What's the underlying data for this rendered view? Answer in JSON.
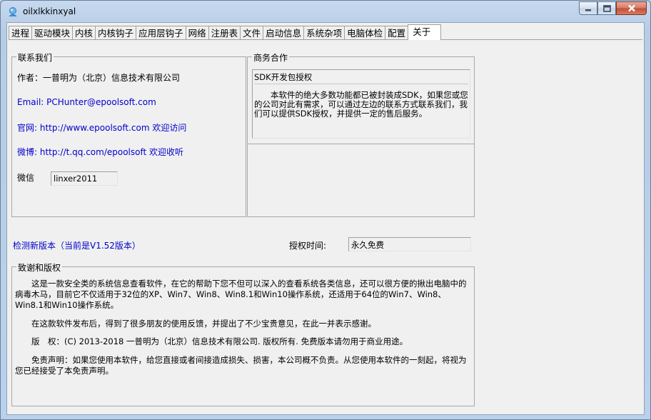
{
  "window": {
    "title": "oilxlkkinxyal"
  },
  "tabs": [
    {
      "label": "进程"
    },
    {
      "label": "驱动模块"
    },
    {
      "label": "内核"
    },
    {
      "label": "内核钩子"
    },
    {
      "label": "应用层钩子"
    },
    {
      "label": "网络"
    },
    {
      "label": "注册表"
    },
    {
      "label": "文件"
    },
    {
      "label": "启动信息"
    },
    {
      "label": "系统杂项"
    },
    {
      "label": "电脑体检"
    },
    {
      "label": "配置"
    },
    {
      "label": "关于"
    }
  ],
  "contact": {
    "group_title": "联系我们",
    "author": "作者：一普明为（北京）信息技术有限公司",
    "email": "Email: PCHunter@epoolsoft.com",
    "website": "官网: http://www.epoolsoft.com 欢迎访问",
    "weibo": "微博: http://t.qq.com/epoolsoft 欢迎收听",
    "wechat_label": "微信",
    "wechat_value": "linxer2011"
  },
  "business": {
    "group_title": "商务合作",
    "box_title": "SDK开发包授权",
    "box_text": "本软件的绝大多数功能都已被封装成SDK，如果您或您的公司对此有需求，可以通过左边的联系方式联系我们，我们可以提供SDK授权，并提供一定的售后服务。"
  },
  "version": {
    "check_link": "检测新版本（当前是V1.52版本）",
    "license_label": "授权时间:",
    "license_value": "永久免费"
  },
  "thanks": {
    "group_title": "致谢和版权",
    "p1": "这是一款安全类的系统信息查看软件，在它的帮助下您不但可以深入的查看系统各类信息，还可以很方便的揪出电脑中的病毒木马，目前它不仅适用于32位的XP、Win7、Win8、Win8.1和Win10操作系统，还适用于64位的Win7、Win8、Win8.1和Win10操作系统。",
    "p2": "在这款软件发布后，得到了很多朋友的使用反馈，并提出了不少宝贵意见，在此一并表示感谢。",
    "p3": "版　权：(C) 2013-2018 一普明为（北京）信息技术有限公司. 版权所有. 免费版本请勿用于商业用途。",
    "p4": "免责声明：如果您使用本软件，给您直接或者间接造成损失、损害，本公司概不负责。从您使用本软件的一刻起，将视为您已经接受了本免责声明。"
  }
}
